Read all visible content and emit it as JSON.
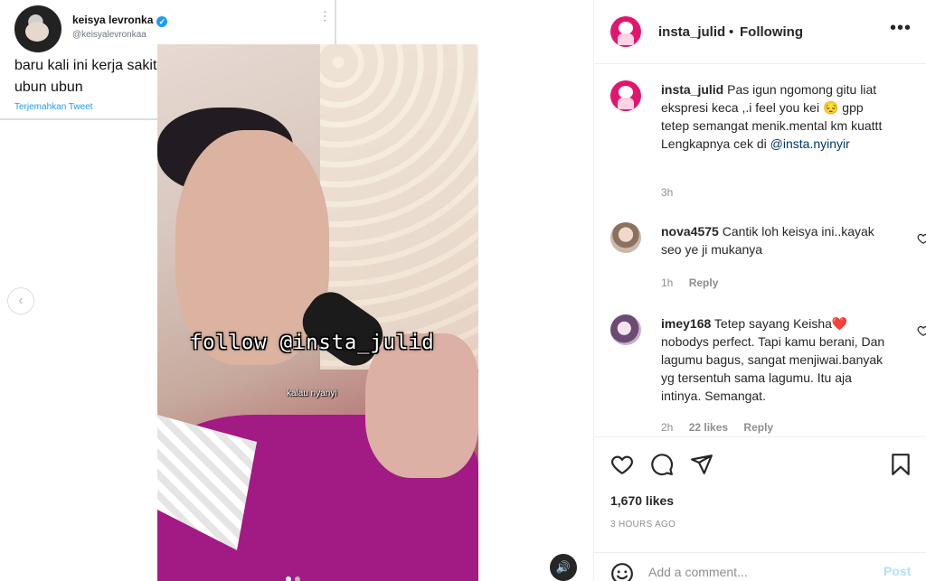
{
  "tweet": {
    "name": "keisya levronka",
    "verified_mark": "✓",
    "handle": "@keisyalevronkaa",
    "more_glyph": "⋯",
    "text": "baru kali ini kerja sakit hatinya kerasa ampe ubun ubun",
    "translate": "Terjemahkan Tweet"
  },
  "video": {
    "caption": "follow @insta_julid",
    "subtitle": "kalau nyanyi"
  },
  "carousel": {
    "prev_glyph": "‹",
    "audio_glyph": "🔊"
  },
  "header": {
    "username": "insta_julid",
    "separator": "•",
    "following": "Following",
    "more_glyph": "•••"
  },
  "caption": {
    "username": "insta_julid",
    "text": "Pas igun ngomong gitu liat ekspresi keca ,.i feel you kei 😔 gpp tetep semangat menik.mental km kuattt",
    "more_prefix": "Lengkapnya cek di",
    "more_link": "@insta.nyinyir",
    "time": "3h"
  },
  "comments": [
    {
      "username": "nova4575",
      "text": "Cantik loh keisya ini..kayak seo ye ji mukanya",
      "time": "1h",
      "likes": "",
      "reply": "Reply"
    },
    {
      "username": "imey168",
      "text": "Tetep sayang Keisha❤️ nobodys perfect. Tapi kamu berani, Dan lagumu bagus, sangat menjiwai.banyak yg tersentuh sama lagumu. Itu aja intinya. Semangat.",
      "time": "2h",
      "likes": "22 likes",
      "reply": "Reply"
    }
  ],
  "actions": {
    "like_icon": "heart-icon",
    "comment_icon": "comment-icon",
    "share_icon": "paper-plane-icon",
    "save_icon": "bookmark-icon",
    "likes": "1,670 likes",
    "time_ago": "3 HOURS AGO"
  },
  "add_comment": {
    "placeholder": "Add a comment...",
    "post_label": "Post"
  },
  "colors": {
    "link": "#00376b",
    "post_disabled": "#b2dffc",
    "brand_avatar": "#e0156f",
    "verified": "#1d9bf0"
  }
}
